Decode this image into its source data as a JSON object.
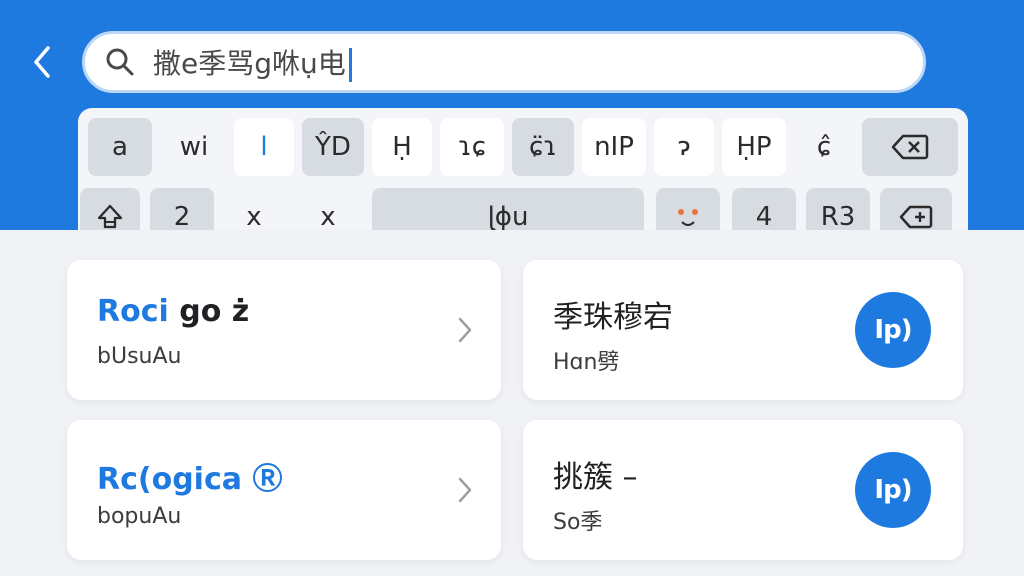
{
  "search": {
    "query": "撒e季骂g咻ụ电"
  },
  "keyboard": {
    "row1": [
      "a",
      "wi",
      "l",
      "ŶD",
      "Ḥ",
      "ɿɕ",
      "ɕ̈ɿ",
      "nIP",
      "ɂ",
      "ḤP",
      "ɕ̂"
    ],
    "row2": [
      "2",
      "x",
      "x",
      "ɭɸu",
      "4",
      "R3"
    ]
  },
  "cards": [
    {
      "title_blue": "Roci",
      "title_dark": "go ż",
      "subtitle": "bUsuAu"
    },
    {
      "title": "季珠穆宕",
      "subtitle": "Hɑn劈",
      "play_label": "Ip)"
    },
    {
      "title_blue": "Rc(ogica",
      "title_dark": "Ⓡ",
      "subtitle": "bopuAu"
    },
    {
      "title": "挑簇 –",
      "subtitle": "So季",
      "play_label": "Ip)"
    }
  ],
  "colors": {
    "accent": "#1f7ae0",
    "background": "#f0f2f6",
    "card": "#ffffff"
  }
}
